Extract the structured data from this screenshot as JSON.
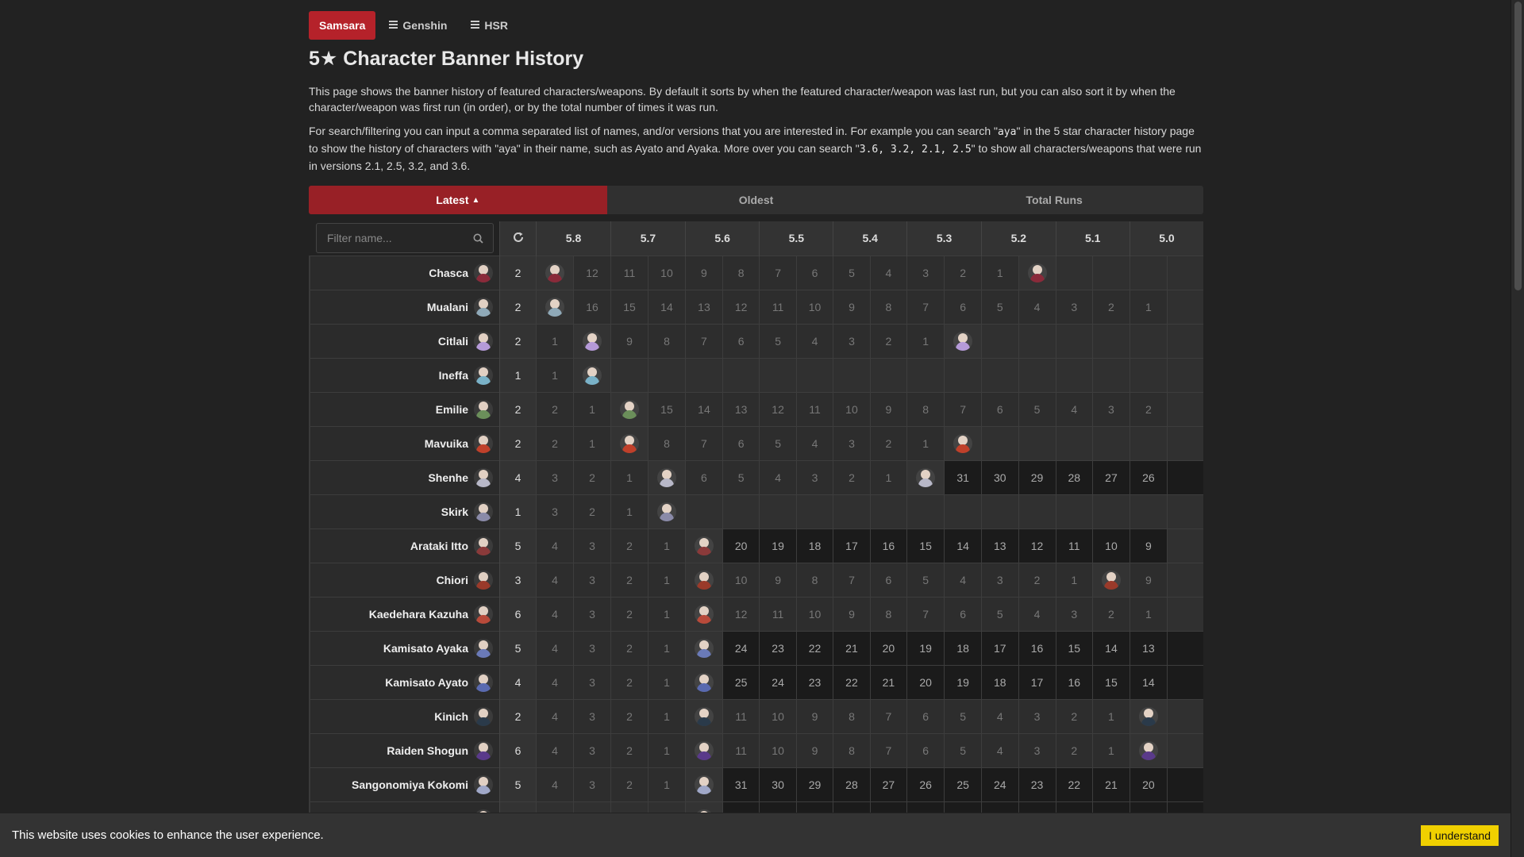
{
  "nav": {
    "brand": "Samsara",
    "items": [
      "Genshin",
      "HSR"
    ]
  },
  "title": "5★ Character Banner History",
  "description": {
    "p1": "This page shows the banner history of featured characters/weapons. By default it sorts by when the featured character/weapon was last run, but you can also sort it by when the character/weapon was first run (in order), or by the total number of times it was run.",
    "p2_a": "For search/filtering you can input a comma separated list of names, and/or versions that you are interested in. For example you can search \"",
    "p2_code1": "aya",
    "p2_b": "\" in the 5 star character history page to show the history of characters with \"aya\" in their name, such as Ayato and Ayaka. More over you can search \"",
    "p2_code2": "3.6, 3.2, 2.1, 2.5",
    "p2_c": "\" to show all characters/weapons that were run in versions 2.1, 2.5, 3.2, and 3.6."
  },
  "sort_tabs": [
    "Latest",
    "Oldest",
    "Total Runs"
  ],
  "filter": {
    "placeholder": "Filter name..."
  },
  "versions": [
    "5.8",
    "5.7",
    "5.6",
    "5.5",
    "5.4",
    "5.3",
    "5.2",
    "5.1",
    "5.0"
  ],
  "rows": [
    {
      "name": "Chasca",
      "count": "2",
      "color": "#8a2a3a",
      "cells": [
        "A",
        "12",
        "11",
        "10",
        "9",
        "8",
        "7",
        "6",
        "5",
        "4",
        "3",
        "2",
        "1",
        "A",
        "",
        "",
        "",
        "E"
      ],
      "fill": "g"
    },
    {
      "name": "Mualani",
      "count": "2",
      "color": "#8fa9b8",
      "cells": [
        "A",
        "16",
        "15",
        "14",
        "13",
        "12",
        "11",
        "10",
        "9",
        "8",
        "7",
        "6",
        "5",
        "4",
        "3",
        "2",
        "1",
        "E"
      ],
      "fill": "g"
    },
    {
      "name": "Citlali",
      "count": "2",
      "color": "#b59ad8",
      "cells": [
        "1",
        "A",
        "9",
        "8",
        "7",
        "6",
        "5",
        "4",
        "3",
        "2",
        "1",
        "A",
        "",
        "",
        "",
        "",
        "",
        ""
      ],
      "fill": "g"
    },
    {
      "name": "Ineffa",
      "count": "1",
      "color": "#7ab2c8",
      "cells": [
        "1",
        "A",
        "",
        "",
        "",
        "",
        "",
        "",
        "",
        "",
        "",
        "",
        "",
        "",
        "",
        "",
        "",
        ""
      ],
      "fill": "g"
    },
    {
      "name": "Emilie",
      "count": "2",
      "color": "#6b8f5a",
      "cells": [
        "2",
        "1",
        "A",
        "15",
        "14",
        "13",
        "12",
        "11",
        "10",
        "9",
        "8",
        "7",
        "6",
        "5",
        "4",
        "3",
        "2",
        "E"
      ],
      "fill": "g"
    },
    {
      "name": "Mavuika",
      "count": "2",
      "color": "#c0402a",
      "cells": [
        "2",
        "1",
        "A",
        "8",
        "7",
        "6",
        "5",
        "4",
        "3",
        "2",
        "1",
        "A",
        "",
        "",
        "",
        "",
        "",
        ""
      ],
      "fill": "g"
    },
    {
      "name": "Shenhe",
      "count": "4",
      "color": "#b8b8c8",
      "cells": [
        "3",
        "2",
        "1",
        "A",
        "6",
        "5",
        "4",
        "3",
        "2",
        "1",
        "A",
        "31",
        "30",
        "29",
        "28",
        "27",
        "26",
        "X"
      ],
      "fill": "g",
      "dark_from": 11
    },
    {
      "name": "Skirk",
      "count": "1",
      "color": "#8a8aa8",
      "cells": [
        "3",
        "2",
        "1",
        "A",
        "",
        "",
        "",
        "",
        "",
        "",
        "",
        "",
        "",
        "",
        "",
        "",
        "",
        ""
      ],
      "fill": "g"
    },
    {
      "name": "Arataki Itto",
      "count": "5",
      "color": "#8a3a3a",
      "cells": [
        "4",
        "3",
        "2",
        "1",
        "A",
        "20",
        "19",
        "18",
        "17",
        "16",
        "15",
        "14",
        "13",
        "12",
        "11",
        "10",
        "9",
        "E"
      ],
      "fill": "g",
      "dark_from": 5
    },
    {
      "name": "Chiori",
      "count": "3",
      "color": "#9a3a2a",
      "cells": [
        "4",
        "3",
        "2",
        "1",
        "A",
        "10",
        "9",
        "8",
        "7",
        "6",
        "5",
        "4",
        "3",
        "2",
        "1",
        "A",
        "9",
        "E"
      ],
      "fill": "g"
    },
    {
      "name": "Kaedehara Kazuha",
      "count": "6",
      "color": "#b84a3a",
      "cells": [
        "4",
        "3",
        "2",
        "1",
        "A",
        "12",
        "11",
        "10",
        "9",
        "8",
        "7",
        "6",
        "5",
        "4",
        "3",
        "2",
        "1",
        "E"
      ],
      "fill": "g"
    },
    {
      "name": "Kamisato Ayaka",
      "count": "5",
      "color": "#6a7ab8",
      "cells": [
        "4",
        "3",
        "2",
        "1",
        "A",
        "24",
        "23",
        "22",
        "21",
        "20",
        "19",
        "18",
        "17",
        "16",
        "15",
        "14",
        "13",
        "X"
      ],
      "fill": "g",
      "dark_from": 5
    },
    {
      "name": "Kamisato Ayato",
      "count": "4",
      "color": "#5a6ab0",
      "cells": [
        "4",
        "3",
        "2",
        "1",
        "A",
        "25",
        "24",
        "23",
        "22",
        "21",
        "20",
        "19",
        "18",
        "17",
        "16",
        "15",
        "14",
        "X"
      ],
      "fill": "g",
      "dark_from": 5
    },
    {
      "name": "Kinich",
      "count": "2",
      "color": "#2a3a4a",
      "cells": [
        "4",
        "3",
        "2",
        "1",
        "A",
        "11",
        "10",
        "9",
        "8",
        "7",
        "6",
        "5",
        "4",
        "3",
        "2",
        "1",
        "A",
        "E"
      ],
      "fill": "g"
    },
    {
      "name": "Raiden Shogun",
      "count": "6",
      "color": "#5a3a8a",
      "cells": [
        "4",
        "3",
        "2",
        "1",
        "A",
        "11",
        "10",
        "9",
        "8",
        "7",
        "6",
        "5",
        "4",
        "3",
        "2",
        "1",
        "A",
        "E"
      ],
      "fill": "g"
    },
    {
      "name": "Sangonomiya Kokomi",
      "count": "5",
      "color": "#a0a8c8",
      "cells": [
        "4",
        "3",
        "2",
        "1",
        "A",
        "31",
        "30",
        "29",
        "28",
        "27",
        "26",
        "25",
        "24",
        "23",
        "22",
        "21",
        "20",
        "X"
      ],
      "fill": "g",
      "dark_from": 5
    },
    {
      "name": "",
      "count": "",
      "color": "#888",
      "cells": [
        "",
        "",
        "",
        "",
        "A",
        "",
        "",
        "",
        "",
        "",
        "",
        "",
        "",
        "",
        "",
        "",
        "",
        ""
      ],
      "fill": "g",
      "dark_from": 5
    }
  ],
  "cookie": {
    "text": "This website uses cookies to enhance the user experience.",
    "button": "I understand"
  }
}
